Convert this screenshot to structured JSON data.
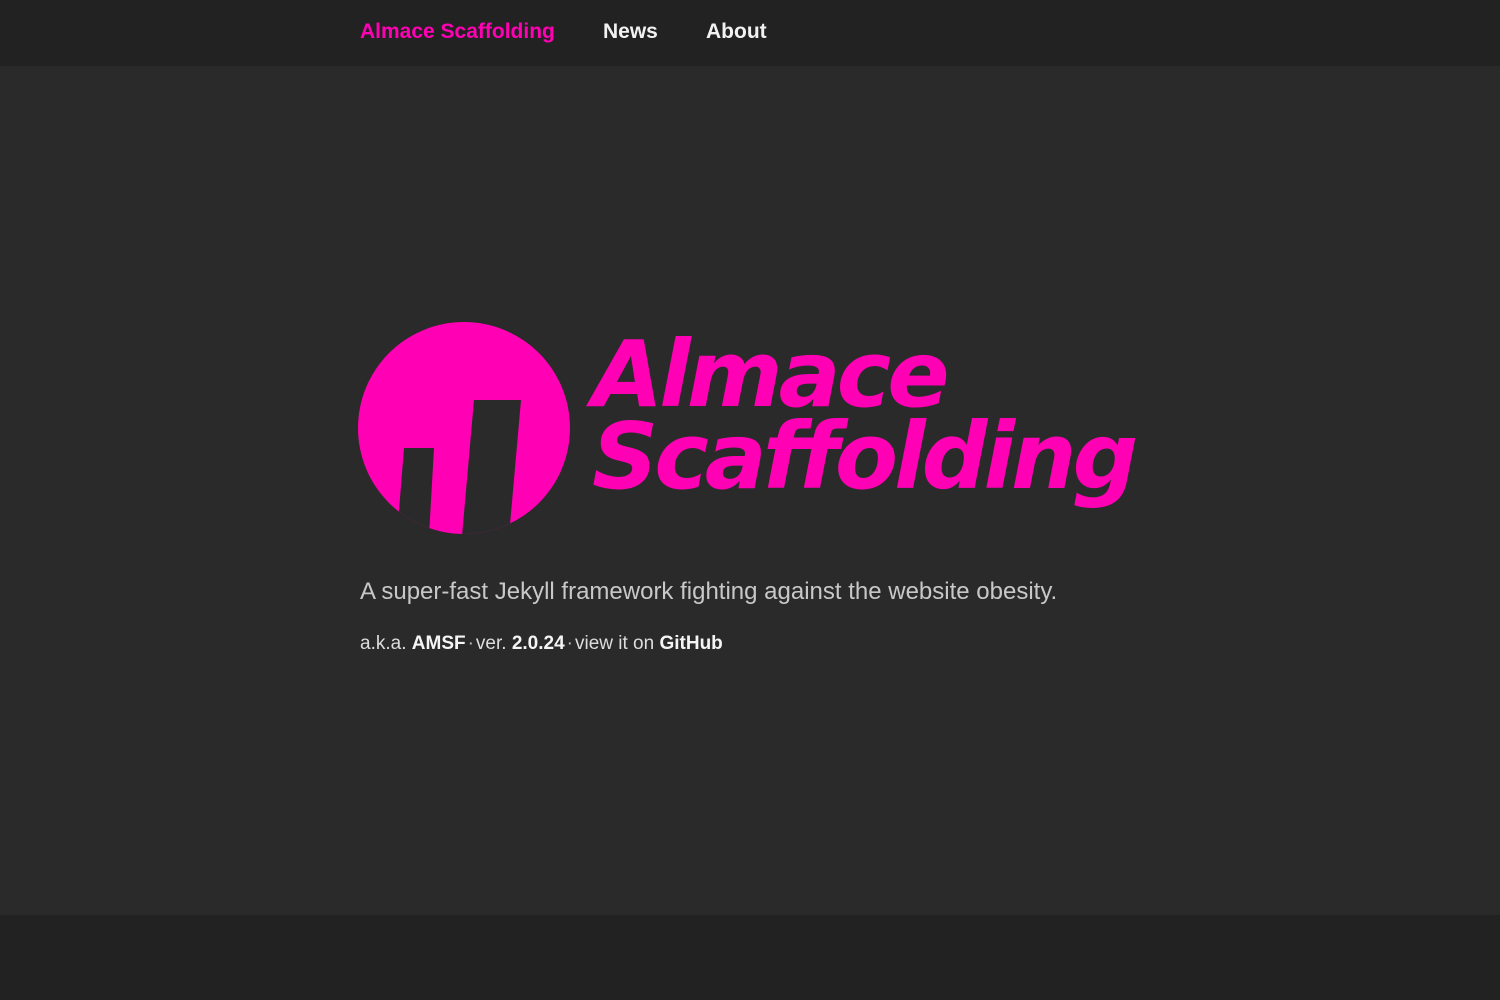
{
  "nav": {
    "brand": "Almace Scaffolding",
    "links": [
      {
        "label": "News"
      },
      {
        "label": "About"
      }
    ]
  },
  "hero": {
    "logo_icon": "amsf-logo-icon",
    "logo_line1": "Almace",
    "logo_line2": "Scaffolding",
    "tagline": "A super-fast Jekyll framework fighting against the website obesity.",
    "meta": {
      "aka_prefix": "a.k.a.",
      "aka_value": "AMSF",
      "separator": "·",
      "version_prefix": "ver.",
      "version_value": "2.0.24",
      "github_prefix": "view it on",
      "github_label": "GitHub"
    }
  },
  "colors": {
    "accent": "#ff00b4",
    "nav_background": "#222222",
    "page_background": "#2a2a2a",
    "text": "#f2f2f2",
    "muted_text": "#c8c8c8"
  }
}
